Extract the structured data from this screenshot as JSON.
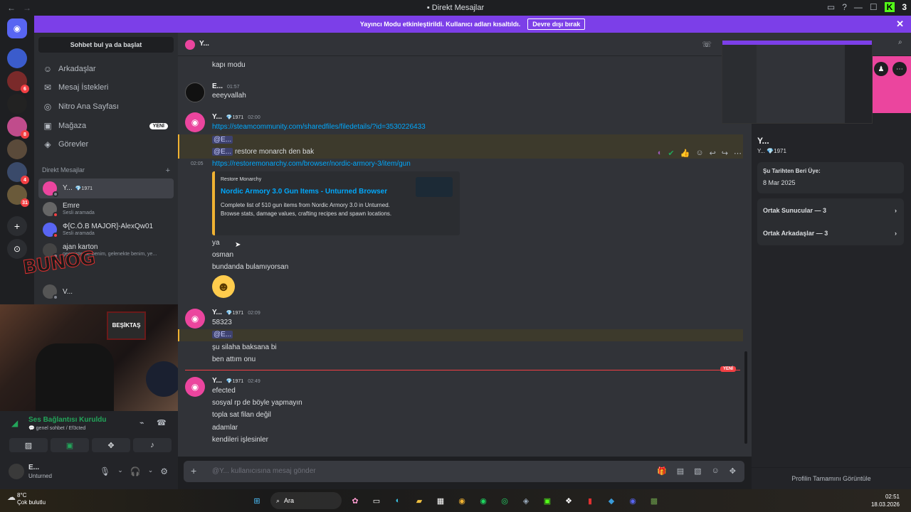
{
  "window": {
    "title": "Direkt Mesajlar",
    "brand_badge": "3"
  },
  "banner": {
    "text": "Yayıncı Modu etkinleştirildi. Kullanıcı adları kısaltıldı.",
    "button": "Devre dışı bırak"
  },
  "servers": {
    "items": [
      {
        "name": "zirve-server-icon",
        "color": "#3b5ccc",
        "badge": ""
      },
      {
        "name": "server-icon-2",
        "color": "#7a2a2a",
        "badge": "6"
      },
      {
        "name": "server-icon-3",
        "color": "#222222",
        "badge": ""
      },
      {
        "name": "server-icon-4",
        "color": "#c04c8c",
        "badge": "8"
      },
      {
        "name": "server-icon-5",
        "color": "#5a4a3a",
        "badge": ""
      },
      {
        "name": "server-icon-6",
        "color": "#3a4a6a",
        "badge": "4"
      },
      {
        "name": "server-icon-7",
        "color": "#6a5a3a",
        "badge": "31"
      }
    ]
  },
  "dm_sidebar": {
    "search_placeholder": "Sohbet bul ya da başlat",
    "nav": [
      {
        "label": "Arkadaşlar",
        "icon": "friends-icon"
      },
      {
        "label": "Mesaj İstekleri",
        "icon": "mail-icon"
      },
      {
        "label": "Nitro Ana Sayfası",
        "icon": "nitro-icon"
      },
      {
        "label": "Mağaza",
        "icon": "shop-icon",
        "badge": "YENİ"
      },
      {
        "label": "Görevler",
        "icon": "quests-icon"
      }
    ],
    "header": "Direkt Mesajlar",
    "dms": [
      {
        "name": "Y...",
        "tag": "💎1971",
        "sub": "",
        "active": true
      },
      {
        "name": "Emre",
        "tag": "",
        "sub": "Sesli aramada",
        "active": false
      },
      {
        "name": "Ф[C.Ö.B MAJOR]-AlexQw01",
        "tag": "",
        "sub": "Sesli aramada",
        "active": false
      },
      {
        "name": "ajan karton",
        "tag": "",
        "sub": "geçmişteyse benim, gelenekte benim, ye...",
        "active": false
      },
      {
        "name": "V...",
        "tag": "",
        "sub": "",
        "active": false
      }
    ]
  },
  "webcam": {
    "flag_text": "BEŞİKTAŞ"
  },
  "overlay_logo": "BUNOG",
  "voice": {
    "status": "Ses Bağlantısı Kuruldu",
    "channel": "💬 genel sohbet / Ef3cted"
  },
  "user_panel": {
    "name": "E...",
    "game": "Unturned"
  },
  "chat_header": {
    "name": "Y..."
  },
  "messages": {
    "m0_line": "kapı modu",
    "m1": {
      "author": "E...",
      "time": "01:57",
      "line": "eeeyvallah"
    },
    "m2": {
      "author": "Y...",
      "tag": "💎1971",
      "time": "02:00",
      "link1": "https://steamcommunity.com/sharedfiles/filedetails/?id=3530226433",
      "mention1": "@E...",
      "mention2": "@E...",
      "text2": "restore monarch den bak",
      "side_time": "02:05",
      "link2": "https://restoremonarchy.com/browser/nordic-armory-3/item/gun"
    },
    "embed": {
      "provider": "Restore Monarchy",
      "title": "Nordic Armory 3.0 Gun Items - Unturned Browser",
      "desc": "Complete list of 510 gun items from Nordic Armory 3.0 in Unturned. Browse stats, damage values, crafting recipes and spawn locations."
    },
    "cont": [
      "ya",
      "osman",
      "bundanda bulamıyorsan"
    ],
    "m3": {
      "author": "Y...",
      "tag": "💎1971",
      "time": "02:09",
      "line1": "58323",
      "mention": "@E...",
      "line2": "şu silaha baksana bi",
      "line3": "ben attım onu"
    },
    "new_label": "YENİ",
    "m4": {
      "author": "Y...",
      "tag": "💎1971",
      "time": "02:49",
      "lines": [
        "efected",
        "sosyal rp de böyle yapmayın",
        "topla sat filan değil",
        "adamlar",
        "kendileri işlesinler"
      ]
    }
  },
  "composer": {
    "placeholder": "@Y... kullanıcısına mesaj gönder"
  },
  "profile": {
    "name": "Y...",
    "sub": "Y...  💎1971",
    "member_since_label": "Şu Tarihten Beri Üye:",
    "member_since": "8 Mar 2025",
    "mutual_servers": "Ortak Sunucular — 3",
    "mutual_friends": "Ortak Arkadaşlar — 3",
    "footer": "Profilin Tamamını Görüntüle"
  },
  "taskbar": {
    "temp": "8°C",
    "weather": "Çok bulutlu",
    "search": "Ara",
    "time": "02:51",
    "date": "18.03.2026"
  },
  "colors": {
    "accent": "#5865f2",
    "banner": "#7c3fe8",
    "link": "#00a8fc",
    "online": "#23a55a",
    "alert": "#f23f43",
    "pink": "#eb459e"
  }
}
